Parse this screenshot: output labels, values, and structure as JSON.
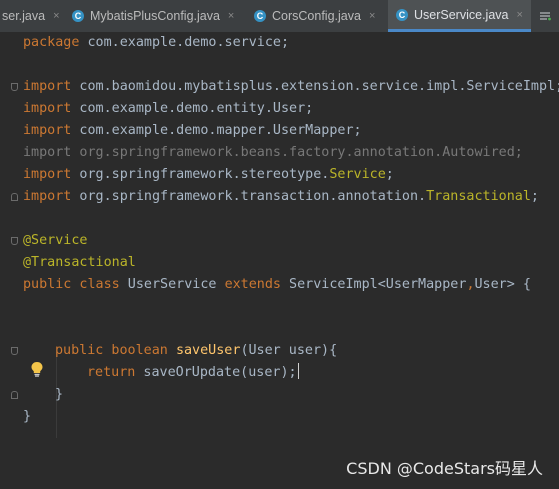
{
  "tabs": [
    {
      "label": "ser.java",
      "active": false,
      "icon": "java-file-icon"
    },
    {
      "label": "MybatisPlusConfig.java",
      "active": false,
      "icon": "class-icon"
    },
    {
      "label": "CorsConfig.java",
      "active": false,
      "icon": "class-icon"
    },
    {
      "label": "UserService.java",
      "active": true,
      "icon": "class-icon"
    }
  ],
  "tab_close_glyph": "×",
  "tab_icon_letter": "C",
  "code": {
    "l1": {
      "kw": "package",
      "rest": " com.example.demo.service;"
    },
    "l3": {
      "kw": "import",
      "rest": " com.baomidou.mybatisplus.extension.service.impl.ServiceImpl;"
    },
    "l4": {
      "kw": "import",
      "rest": " com.example.demo.entity.User;"
    },
    "l5": {
      "kw": "import",
      "rest": " com.example.demo.mapper.UserMapper;"
    },
    "l6": {
      "text": "import org.springframework.beans.factory.annotation.Autowired;"
    },
    "l7": {
      "kw": "import",
      "pre": " org.springframework.stereotype.",
      "ann": "Service",
      "post": ";"
    },
    "l8": {
      "kw": "import",
      "pre": " org.springframework.transaction.annotation.",
      "ann": "Transactional",
      "post": ";"
    },
    "l10": {
      "ann": "@Service"
    },
    "l11": {
      "ann": "@Transactional"
    },
    "l12": {
      "kw1": "public class",
      "name": " UserService ",
      "kw2": "extends",
      "rest": " ServiceImpl<UserMapper",
      "comma": ",",
      "rest2": "User> {"
    },
    "l15": {
      "kw": "public boolean",
      "sp": " ",
      "fn": "saveUser",
      "rest": "(User user){"
    },
    "l16": {
      "kw": "return",
      "rest": " saveOrUpdate(user);"
    },
    "l17": {
      "text": "}"
    },
    "l18": {
      "text": "}"
    }
  },
  "watermark": "CSDN @CodeStars码星人",
  "colors": {
    "background": "#2b2b2b",
    "keyword": "#cc7832",
    "annotation": "#bbb529",
    "method": "#ffc66d",
    "text": "#a9b7c6",
    "active_tab": "#4a88c7"
  }
}
